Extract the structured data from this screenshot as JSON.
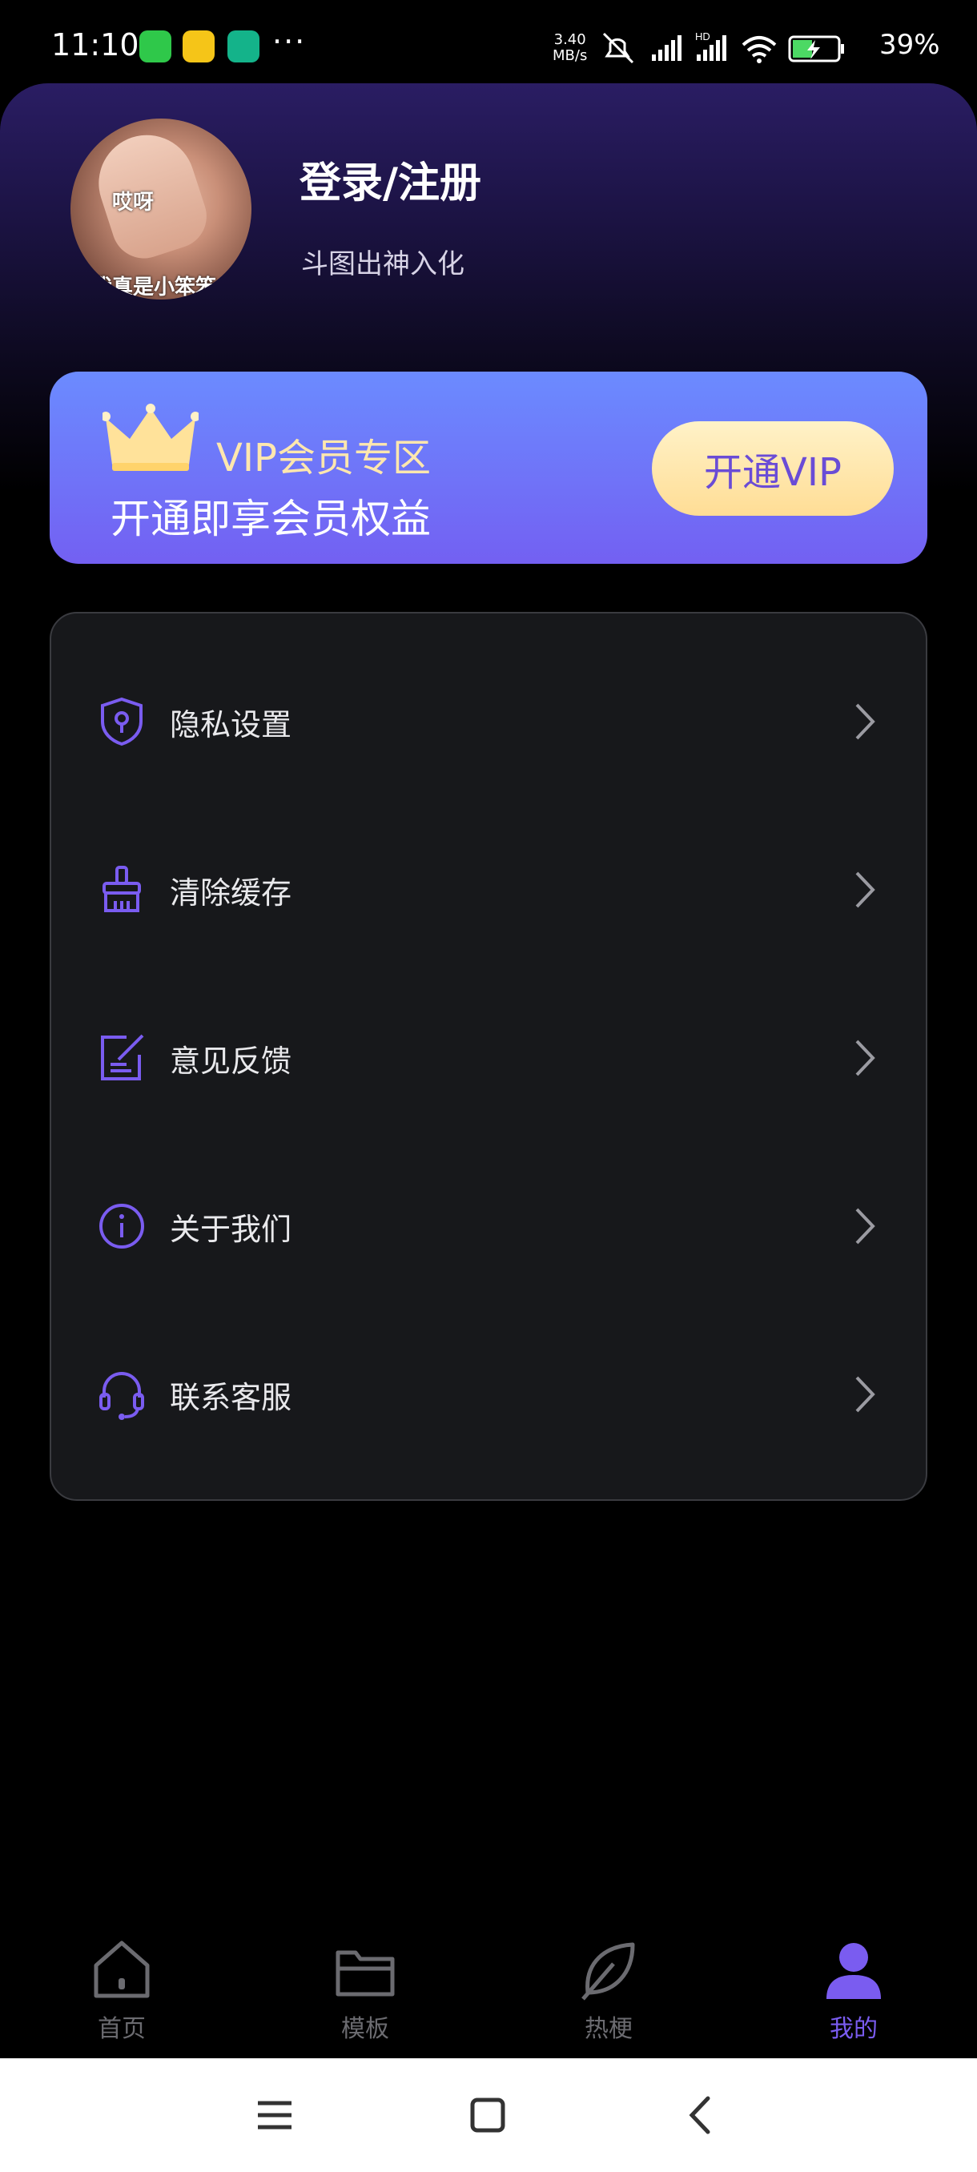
{
  "status_bar": {
    "time": "11:10",
    "dots": "···",
    "speed_value": "3.40",
    "speed_unit": "MB/s",
    "network_label": "HD",
    "battery": "39%"
  },
  "profile": {
    "avatar_text_top": "哎呀",
    "avatar_text_bottom": "我真是小笨笨",
    "title": "登录/注册",
    "subtitle": "斗图出神入化"
  },
  "vip": {
    "title": "VIP会员专区",
    "subtitle": "开通即享会员权益",
    "button_label": "开通VIP"
  },
  "menu": {
    "items": [
      {
        "label": "隐私设置",
        "icon": "shield-lock-icon"
      },
      {
        "label": "清除缓存",
        "icon": "broom-icon"
      },
      {
        "label": "意见反馈",
        "icon": "edit-note-icon"
      },
      {
        "label": "关于我们",
        "icon": "info-icon"
      },
      {
        "label": "联系客服",
        "icon": "headset-icon"
      }
    ]
  },
  "tabs": [
    {
      "label": "首页",
      "icon": "home-icon",
      "active": false
    },
    {
      "label": "模板",
      "icon": "folder-icon",
      "active": false
    },
    {
      "label": "热梗",
      "icon": "leaf-icon",
      "active": false
    },
    {
      "label": "我的",
      "icon": "user-icon",
      "active": true
    }
  ],
  "colors": {
    "accent": "#7a5cf0",
    "vip_gold": "#ffe7ae",
    "card_bg": "#17181b"
  }
}
